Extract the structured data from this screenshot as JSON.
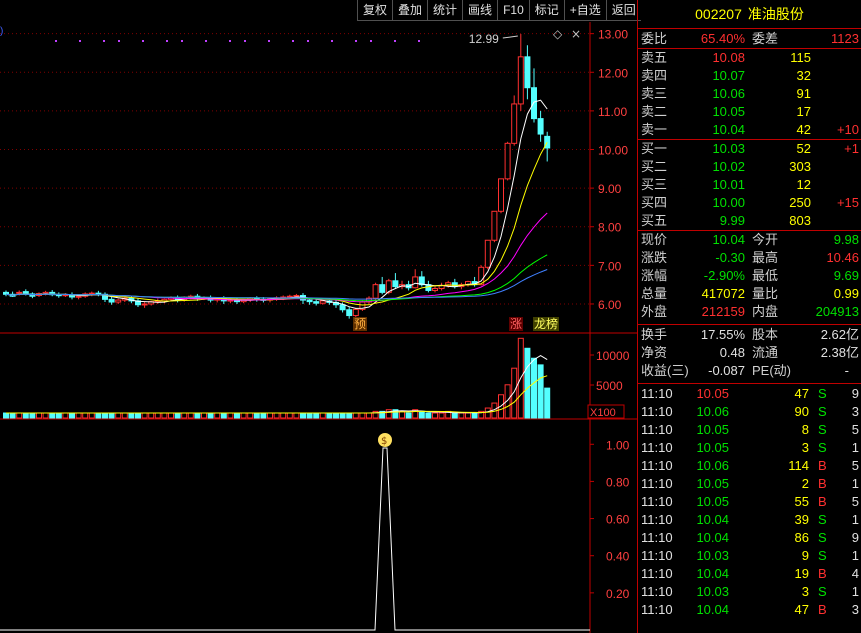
{
  "toolbar": {
    "buttons": [
      "复权",
      "叠加",
      "统计",
      "画线",
      "F10",
      "标记",
      "+自选",
      "返回"
    ]
  },
  "stock": {
    "code": "002207",
    "name": "准油股份"
  },
  "order_ratio": {
    "wb_label": "委比",
    "wb_value": "65.40%",
    "wc_label": "委差",
    "wc_value": "1123"
  },
  "asks": [
    {
      "label": "卖五",
      "price": "10.08",
      "vol": "115",
      "chg": ""
    },
    {
      "label": "卖四",
      "price": "10.07",
      "vol": "32",
      "chg": ""
    },
    {
      "label": "卖三",
      "price": "10.06",
      "vol": "91",
      "chg": ""
    },
    {
      "label": "卖二",
      "price": "10.05",
      "vol": "17",
      "chg": ""
    },
    {
      "label": "卖一",
      "price": "10.04",
      "vol": "42",
      "chg": "+10"
    }
  ],
  "bids": [
    {
      "label": "买一",
      "price": "10.03",
      "vol": "52",
      "chg": "+1"
    },
    {
      "label": "买二",
      "price": "10.02",
      "vol": "303",
      "chg": ""
    },
    {
      "label": "买三",
      "price": "10.01",
      "vol": "12",
      "chg": ""
    },
    {
      "label": "买四",
      "price": "10.00",
      "vol": "250",
      "chg": "+15"
    },
    {
      "label": "买五",
      "price": "9.99",
      "vol": "803",
      "chg": ""
    }
  ],
  "quote": {
    "xj_label": "现价",
    "xj": "10.04",
    "jk_label": "今开",
    "jk": "9.98",
    "zd_label": "涨跌",
    "zd": "-0.30",
    "zg_label": "最高",
    "zg": "10.46",
    "zf_label": "涨幅",
    "zf": "-2.90%",
    "zdi_label": "最低",
    "zdi": "9.69",
    "zl_label": "总量",
    "zl": "417072",
    "lb_label": "量比",
    "lb": "0.99",
    "wp_label": "外盘",
    "wp": "212159",
    "np_label": "内盘",
    "np": "204913"
  },
  "finance": {
    "hs_label": "换手",
    "hs": "17.55%",
    "gb_label": "股本",
    "gb": "2.62亿",
    "jz_label": "净资",
    "jz": "0.48",
    "lt_label": "流通",
    "lt": "2.38亿",
    "sy_label": "收益(三)",
    "sy": "-0.087",
    "pe_label": "PE(动)",
    "pe": "-"
  },
  "ticks": [
    {
      "time": "11:10",
      "price": "10.05",
      "vol": "47",
      "dir": "S",
      "n": "9"
    },
    {
      "time": "11:10",
      "price": "10.06",
      "vol": "90",
      "dir": "S",
      "n": "3"
    },
    {
      "time": "11:10",
      "price": "10.05",
      "vol": "8",
      "dir": "S",
      "n": "5"
    },
    {
      "time": "11:10",
      "price": "10.05",
      "vol": "3",
      "dir": "S",
      "n": "1"
    },
    {
      "time": "11:10",
      "price": "10.06",
      "vol": "114",
      "dir": "B",
      "n": "5"
    },
    {
      "time": "11:10",
      "price": "10.05",
      "vol": "2",
      "dir": "B",
      "n": "1"
    },
    {
      "time": "11:10",
      "price": "10.05",
      "vol": "55",
      "dir": "B",
      "n": "5"
    },
    {
      "time": "11:10",
      "price": "10.04",
      "vol": "39",
      "dir": "S",
      "n": "1"
    },
    {
      "time": "11:10",
      "price": "10.04",
      "vol": "86",
      "dir": "S",
      "n": "9"
    },
    {
      "time": "11:10",
      "price": "10.03",
      "vol": "9",
      "dir": "S",
      "n": "1"
    },
    {
      "time": "11:10",
      "price": "10.04",
      "vol": "19",
      "dir": "B",
      "n": "4"
    },
    {
      "time": "11:10",
      "price": "10.03",
      "vol": "3",
      "dir": "S",
      "n": "1"
    },
    {
      "time": "11:10",
      "price": "10.04",
      "vol": "47",
      "dir": "B",
      "n": "3"
    }
  ],
  "colors": {
    "up": "#ff3030",
    "down": "#54ffff",
    "ma1": "#ffffff",
    "ma2": "#ffff00",
    "ma3": "#ff00ff",
    "ma4": "#00ff00",
    "ma5": "#4080ff",
    "grid": "#800000"
  },
  "chart_data": {
    "type": "candlestick",
    "price_axis": {
      "ticks": [
        "13.00",
        "12.00",
        "11.00",
        "10.00",
        "9.00",
        "8.00",
        "7.00",
        "6.00"
      ],
      "min": 5.3,
      "max": 13.25
    },
    "volume_axis": {
      "ticks": [
        "10000",
        "5000"
      ],
      "unit": "X100"
    },
    "indicator_axis": {
      "ticks": [
        "1.00",
        "0.80",
        "0.60",
        "0.40",
        "0.20"
      ]
    },
    "high_label": "12.99",
    "markers": {
      "pre": "预",
      "zhang": "涨",
      "longhu": "龙榜"
    },
    "candles": [
      [
        6.3,
        6.35,
        6.25,
        6.2
      ],
      [
        6.25,
        6.32,
        6.2,
        6.18
      ],
      [
        6.28,
        6.35,
        6.3,
        6.22
      ],
      [
        6.32,
        6.38,
        6.26,
        6.22
      ],
      [
        6.26,
        6.3,
        6.2,
        6.15
      ],
      [
        6.22,
        6.3,
        6.27,
        6.18
      ],
      [
        6.27,
        6.34,
        6.3,
        6.22
      ],
      [
        6.3,
        6.36,
        6.24,
        6.2
      ],
      [
        6.24,
        6.3,
        6.22,
        6.16
      ],
      [
        6.22,
        6.28,
        6.24,
        6.18
      ],
      [
        6.24,
        6.3,
        6.18,
        6.12
      ],
      [
        6.18,
        6.24,
        6.2,
        6.12
      ],
      [
        6.2,
        6.3,
        6.26,
        6.16
      ],
      [
        6.26,
        6.32,
        6.28,
        6.2
      ],
      [
        6.28,
        6.34,
        6.25,
        6.2
      ],
      [
        6.25,
        6.3,
        6.12,
        6.05
      ],
      [
        6.12,
        6.2,
        6.05,
        5.98
      ],
      [
        6.05,
        6.14,
        6.1,
        6.0
      ],
      [
        6.1,
        6.18,
        6.15,
        6.05
      ],
      [
        6.15,
        6.2,
        6.08,
        6.02
      ],
      [
        6.08,
        6.15,
        5.98,
        5.92
      ],
      [
        5.98,
        6.05,
        6.0,
        5.9
      ],
      [
        6.0,
        6.08,
        6.06,
        5.96
      ],
      [
        6.06,
        6.14,
        6.08,
        6.0
      ],
      [
        6.08,
        6.14,
        6.12,
        6.02
      ],
      [
        6.12,
        6.2,
        6.16,
        6.08
      ],
      [
        6.16,
        6.22,
        6.1,
        6.04
      ],
      [
        6.1,
        6.2,
        6.18,
        6.06
      ],
      [
        6.18,
        6.24,
        6.2,
        6.12
      ],
      [
        6.2,
        6.26,
        6.14,
        6.08
      ],
      [
        6.14,
        6.2,
        6.16,
        6.1
      ],
      [
        6.16,
        6.22,
        6.1,
        6.04
      ],
      [
        6.1,
        6.18,
        6.14,
        6.04
      ],
      [
        6.14,
        6.2,
        6.08,
        6.0
      ],
      [
        6.08,
        6.14,
        6.1,
        6.02
      ],
      [
        6.1,
        6.16,
        6.06,
        6.0
      ],
      [
        6.06,
        6.12,
        6.1,
        6.02
      ],
      [
        6.1,
        6.18,
        6.15,
        6.05
      ],
      [
        6.15,
        6.2,
        6.12,
        6.06
      ],
      [
        6.12,
        6.18,
        6.1,
        6.04
      ],
      [
        6.1,
        6.16,
        6.14,
        6.04
      ],
      [
        6.14,
        6.2,
        6.16,
        6.08
      ],
      [
        6.16,
        6.22,
        6.18,
        6.1
      ],
      [
        6.18,
        6.24,
        6.2,
        6.12
      ],
      [
        6.2,
        6.26,
        6.22,
        6.14
      ],
      [
        6.22,
        6.28,
        6.1,
        6.0
      ],
      [
        6.1,
        6.16,
        6.06,
        5.98
      ],
      [
        6.06,
        6.12,
        6.02,
        5.96
      ],
      [
        6.02,
        6.1,
        6.08,
        5.98
      ],
      [
        6.08,
        6.14,
        6.04,
        5.98
      ],
      [
        6.04,
        6.1,
        5.98,
        5.9
      ],
      [
        5.98,
        6.04,
        5.85,
        5.78
      ],
      [
        5.85,
        5.92,
        5.7,
        5.62
      ],
      [
        5.7,
        5.9,
        5.86,
        5.65
      ],
      [
        5.86,
        6.1,
        6.05,
        5.82
      ],
      [
        6.05,
        6.2,
        6.15,
        6.0
      ],
      [
        6.15,
        6.55,
        6.5,
        6.1
      ],
      [
        6.5,
        6.7,
        6.3,
        6.25
      ],
      [
        6.3,
        6.65,
        6.6,
        6.25
      ],
      [
        6.6,
        6.8,
        6.45,
        6.4
      ],
      [
        6.45,
        6.6,
        6.5,
        6.38
      ],
      [
        6.5,
        6.6,
        6.42,
        6.35
      ],
      [
        6.42,
        6.9,
        6.7,
        6.4
      ],
      [
        6.7,
        6.85,
        6.5,
        6.45
      ],
      [
        6.5,
        6.6,
        6.35,
        6.3
      ],
      [
        6.35,
        6.48,
        6.4,
        6.3
      ],
      [
        6.4,
        6.55,
        6.48,
        6.35
      ],
      [
        6.48,
        6.6,
        6.55,
        6.42
      ],
      [
        6.55,
        6.65,
        6.45,
        6.4
      ],
      [
        6.45,
        6.55,
        6.5,
        6.38
      ],
      [
        6.5,
        6.6,
        6.58,
        6.45
      ],
      [
        6.58,
        6.7,
        6.5,
        6.45
      ],
      [
        6.5,
        7.0,
        6.95,
        6.48
      ],
      [
        6.95,
        7.65,
        7.65,
        6.9
      ],
      [
        7.65,
        8.4,
        8.4,
        7.6
      ],
      [
        8.4,
        9.25,
        9.24,
        8.35
      ],
      [
        9.24,
        10.2,
        10.16,
        9.2
      ],
      [
        10.16,
        11.4,
        11.18,
        10.1
      ],
      [
        11.18,
        12.99,
        12.4,
        11.0
      ],
      [
        12.4,
        12.7,
        11.6,
        11.3
      ],
      [
        11.6,
        12.1,
        10.8,
        10.7
      ],
      [
        10.8,
        11.0,
        10.4,
        10.2
      ],
      [
        10.34,
        10.46,
        10.04,
        9.69
      ]
    ],
    "volumes": [
      3,
      3,
      3,
      3,
      3,
      3,
      3,
      3,
      3,
      3,
      3,
      3,
      3,
      3,
      3,
      3,
      3,
      3,
      3,
      3,
      3,
      3,
      3,
      3,
      3,
      3,
      3,
      3,
      3,
      3,
      3,
      3,
      3,
      3,
      3,
      3,
      3,
      3,
      3,
      3,
      3,
      3,
      3,
      3,
      3,
      3,
      3,
      3,
      3,
      3,
      3,
      3,
      3,
      3,
      3,
      3,
      4,
      4,
      5,
      5,
      4,
      3,
      5,
      4,
      3,
      3,
      3,
      4,
      3,
      3,
      3,
      3,
      4,
      6,
      9,
      14,
      20,
      30,
      48,
      42,
      36,
      32,
      18
    ],
    "indicator_spike": 0.98
  }
}
